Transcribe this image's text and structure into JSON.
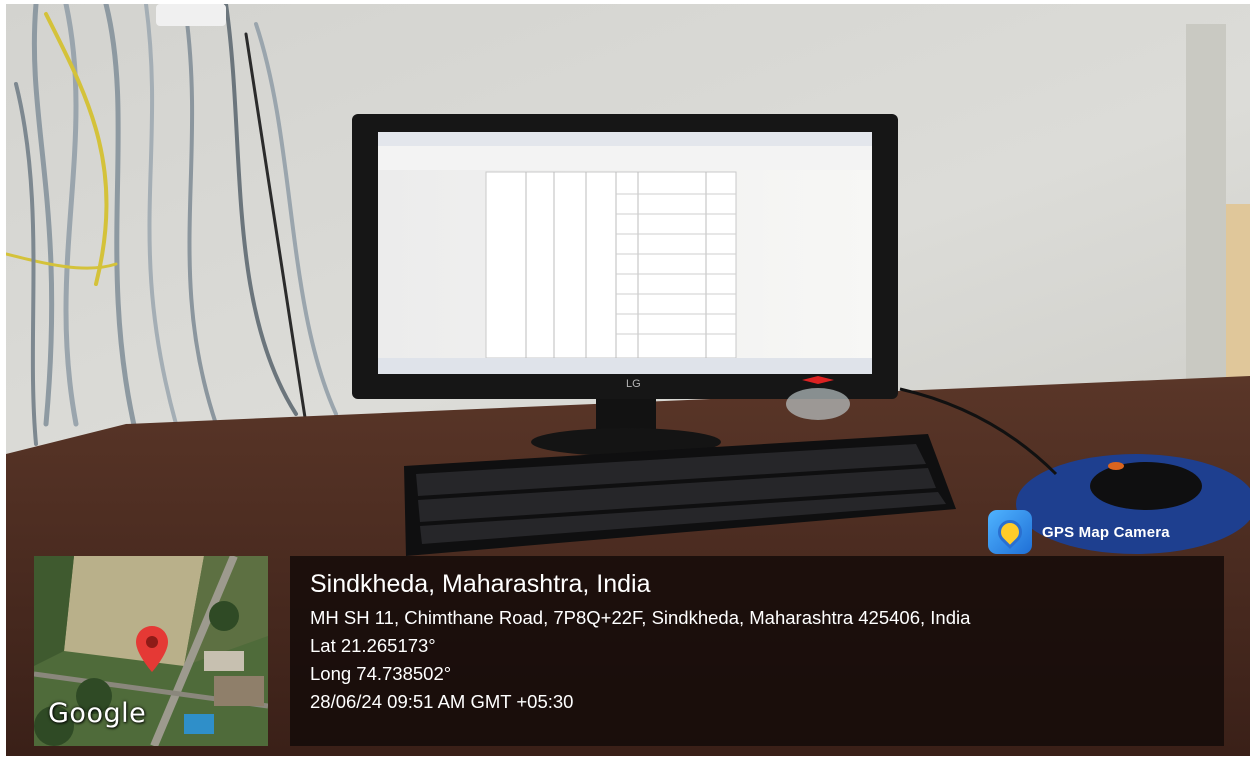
{
  "overlay": {
    "app_badge": {
      "label": "GPS Map Camera",
      "icon": "gps-map-camera-icon"
    },
    "location_title": "Sindkheda, Maharashtra, India",
    "address": "MH SH 11, Chimthane Road, 7P8Q+22F, Sindkheda, Maharashtra 425406, India",
    "latitude": "Lat 21.265173°",
    "longitude": "Long 74.738502°",
    "timestamp": "28/06/24 09:51 AM GMT +05:30"
  },
  "map_thumbnail": {
    "logo_text": "Google",
    "marker_icon": "map-pin-icon"
  },
  "monitor": {
    "brand": "LG"
  },
  "colors": {
    "overlay_bg": "#120a08",
    "pin_red": "#e53935",
    "wall": "#d9d9d4",
    "desk": "#4a2a1e"
  }
}
